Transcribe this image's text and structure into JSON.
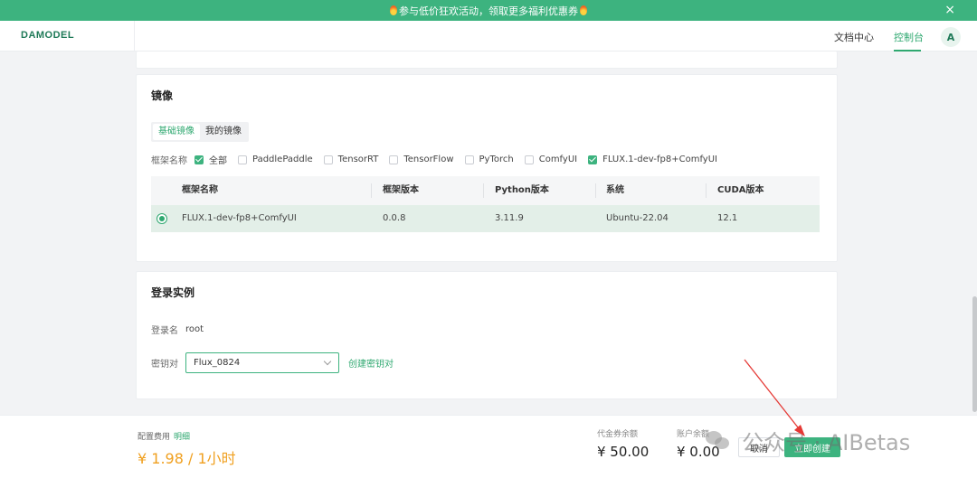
{
  "banner": {
    "text": "参与低价狂欢活动，领取更多福利优惠券",
    "close_icon": "×"
  },
  "header": {
    "logo": "DAMODEL",
    "nav": [
      {
        "label": "文档中心"
      },
      {
        "label": "控制台",
        "active": true
      }
    ],
    "avatar": "A"
  },
  "mirror": {
    "title": "镜像",
    "tabs": [
      {
        "label": "基础镜像",
        "active": true
      },
      {
        "label": "我的镜像"
      }
    ],
    "filter_label": "框架名称",
    "filters": [
      {
        "label": "全部",
        "checked": true
      },
      {
        "label": "PaddlePaddle",
        "checked": false
      },
      {
        "label": "TensorRT",
        "checked": false
      },
      {
        "label": "TensorFlow",
        "checked": false
      },
      {
        "label": "PyTorch",
        "checked": false
      },
      {
        "label": "ComfyUI",
        "checked": false
      },
      {
        "label": "FLUX.1-dev-fp8+ComfyUI",
        "checked": true
      }
    ],
    "table": {
      "headers": [
        "框架名称",
        "框架版本",
        "Python版本",
        "系统",
        "CUDA版本"
      ],
      "rows": [
        {
          "selected": true,
          "cells": [
            "FLUX.1-dev-fp8+ComfyUI",
            "0.0.8",
            "3.11.9",
            "Ubuntu-22.04",
            "12.1"
          ]
        }
      ]
    }
  },
  "login": {
    "title": "登录实例",
    "username_label": "登录名",
    "username_value": "root",
    "keypair_label": "密钥对",
    "keypair_value": "Flux_0824",
    "create_keypair_link": "创建密钥对"
  },
  "footer": {
    "fee_label": "配置费用",
    "fee_detail_link": "明细",
    "fee_price": "¥ 1.98 / 1小时",
    "voucher_label": "代金券余额",
    "voucher_value": "¥ 50.00",
    "account_label": "账户余额",
    "account_value": "¥ 0.00",
    "cancel_button": "取消",
    "create_button": "立即创建"
  },
  "watermark": {
    "text": "公众号 · AIBetas"
  },
  "colors": {
    "accent": "#3db37f",
    "price": "#f0a020",
    "annotation_arrow": "#e53935"
  }
}
